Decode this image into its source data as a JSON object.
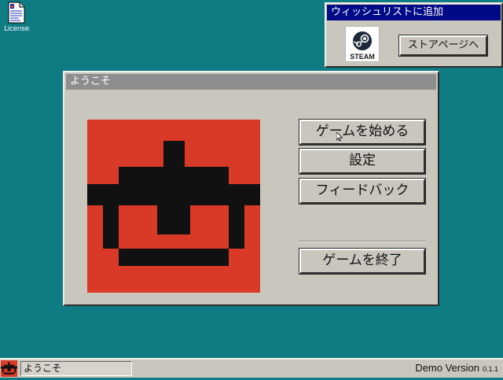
{
  "desktop": {
    "icons": [
      {
        "label": "License",
        "icon": "document-icon"
      }
    ]
  },
  "wishlist_window": {
    "title": "ウィッシュリストに追加",
    "logo_text": "STEAM",
    "store_button_label": "ストアページへ"
  },
  "welcome_window": {
    "title": "ようこそ",
    "menu": {
      "start_label": "ゲームを始める",
      "settings_label": "設定",
      "feedback_label": "フィードバック",
      "quit_label": "ゲームを終了"
    }
  },
  "taskbar": {
    "task_label": "ようこそ",
    "version_label": "Demo Version",
    "version_number": "0.1.1"
  },
  "colors": {
    "desktop": "#0f7c84",
    "window_face": "#c9c6bd",
    "active_titlebar": "#000a86",
    "inactive_titlebar": "#8e8e8e",
    "logo_red": "#d93a28",
    "logo_black": "#111111"
  }
}
